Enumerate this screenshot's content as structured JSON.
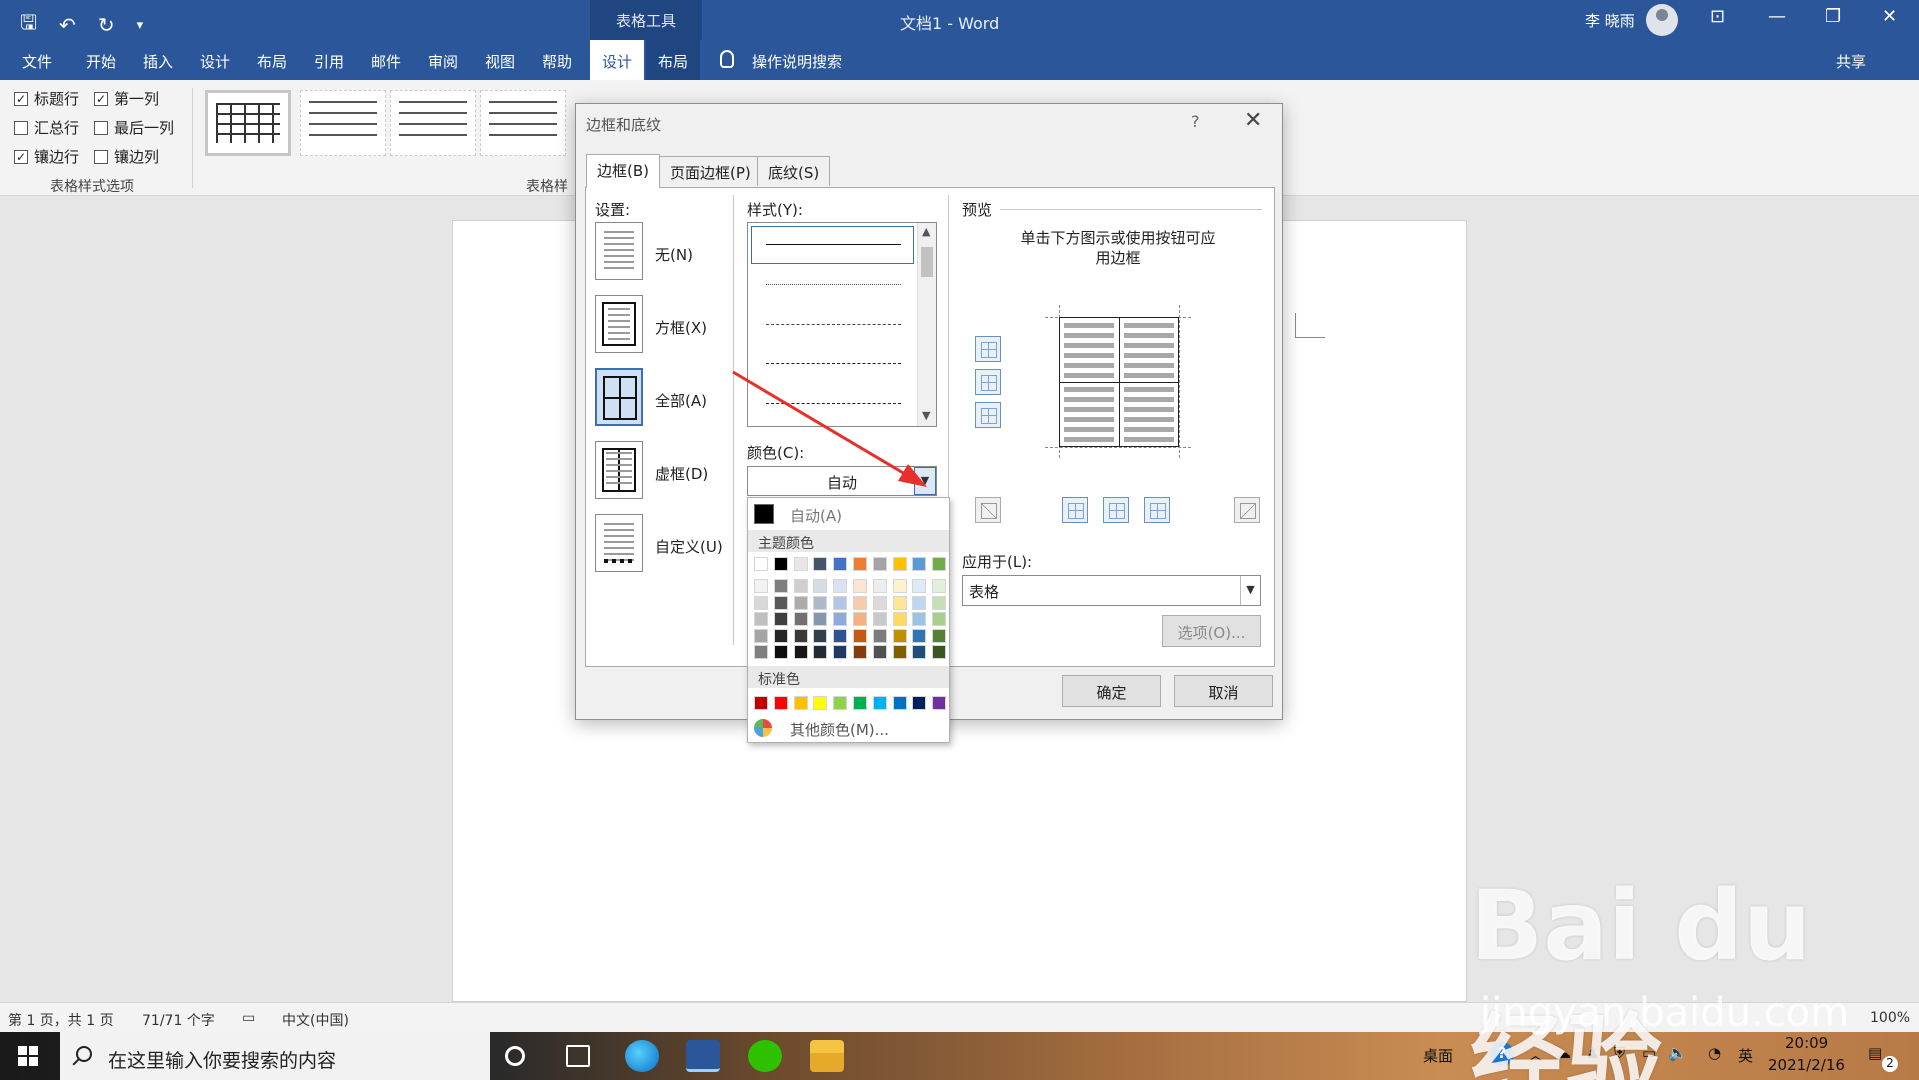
{
  "titlebar": {
    "context_group": "表格工具",
    "doc_title": "文档1  -  Word",
    "user": "李 晓雨",
    "qat": {
      "save": "🖫",
      "undo": "↶",
      "redo": "↻",
      "more": "▾"
    },
    "win": {
      "ribbon_opts": "⊡",
      "minimize": "—",
      "restore": "❐",
      "close": "✕"
    }
  },
  "tabs": [
    {
      "label": "文件"
    },
    {
      "label": "开始"
    },
    {
      "label": "插入"
    },
    {
      "label": "设计"
    },
    {
      "label": "布局"
    },
    {
      "label": "引用"
    },
    {
      "label": "邮件"
    },
    {
      "label": "审阅"
    },
    {
      "label": "视图"
    },
    {
      "label": "帮助"
    },
    {
      "label": "设计"
    },
    {
      "label": "布局"
    }
  ],
  "tell_me": "操作说明搜索",
  "share": "共享",
  "ribbon": {
    "options": [
      {
        "label": "标题行",
        "checked": true
      },
      {
        "label": "第一列",
        "checked": true
      },
      {
        "label": "汇总行",
        "checked": false
      },
      {
        "label": "最后一列",
        "checked": false
      },
      {
        "label": "镶边行",
        "checked": true
      },
      {
        "label": "镶边列",
        "checked": false
      }
    ],
    "group1_label": "表格样式选项",
    "group2_label": "表格样"
  },
  "statusbar": {
    "page": "第 1 页，共 1 页",
    "words": "71/71 个字",
    "lang": "中文(中国)",
    "zoom": "100%"
  },
  "taskbar": {
    "search_placeholder": "在这里输入你要搜索的内容",
    "desktop": "桌面",
    "ime": "英",
    "time": "20:09",
    "date": "2021/2/16",
    "notif_count": "2"
  },
  "dialog": {
    "title": "边框和底纹",
    "help": "?",
    "close": "✕",
    "tabs": [
      "边框(B)",
      "页面边框(P)",
      "底纹(S)"
    ],
    "setting_label": "设置:",
    "settings": [
      "无(N)",
      "方框(X)",
      "全部(A)",
      "虚框(D)",
      "自定义(U)"
    ],
    "style_label": "样式(Y):",
    "color_label": "颜色(C):",
    "color_value": "自动",
    "preview_label": "预览",
    "preview_hint": "单击下方图示或使用按钮可应用边框",
    "apply_label": "应用于(L):",
    "apply_value": "表格",
    "options_btn": "选项(O)...",
    "ok": "确定",
    "cancel": "取消"
  },
  "color_popup": {
    "auto": "自动(A)",
    "theme_header": "主题颜色",
    "standard_header": "标准色",
    "more": "其他颜色(M)...",
    "theme_top": [
      "#ffffff",
      "#000000",
      "#e7e6e6",
      "#44546a",
      "#4472c4",
      "#ed7d31",
      "#a5a5a5",
      "#ffc000",
      "#5b9bd5",
      "#70ad47"
    ],
    "theme_shades": [
      [
        "#f2f2f2",
        "#7f7f7f",
        "#d0cece",
        "#d6dce4",
        "#d9e2f3",
        "#fbe5d5",
        "#ededed",
        "#fff2cc",
        "#deebf6",
        "#e2efd9"
      ],
      [
        "#d8d8d8",
        "#595959",
        "#aeabab",
        "#adb9ca",
        "#b4c6e7",
        "#f7cbac",
        "#dbdbdb",
        "#fee599",
        "#bdd7ee",
        "#c5e0b3"
      ],
      [
        "#bfbfbf",
        "#3f3f3f",
        "#757070",
        "#8496b0",
        "#8eaadb",
        "#f4b183",
        "#c9c9c9",
        "#ffd965",
        "#9cc3e5",
        "#a8d08d"
      ],
      [
        "#a5a5a5",
        "#262626",
        "#3a3838",
        "#323f4f",
        "#2f5496",
        "#c55a11",
        "#7b7b7b",
        "#bf8f00",
        "#2e75b5",
        "#538135"
      ],
      [
        "#7f7f7f",
        "#0c0c0c",
        "#171616",
        "#222a35",
        "#1f3864",
        "#833c0b",
        "#525252",
        "#7f6000",
        "#1e4e79",
        "#375623"
      ]
    ],
    "standard": [
      "#c00000",
      "#ff0000",
      "#ffc000",
      "#ffff00",
      "#92d050",
      "#00b050",
      "#00b0f0",
      "#0070c0",
      "#002060",
      "#7030a0"
    ]
  },
  "watermark": "Bai du 经验",
  "watermark_sub": "jingyan.baidu.com"
}
